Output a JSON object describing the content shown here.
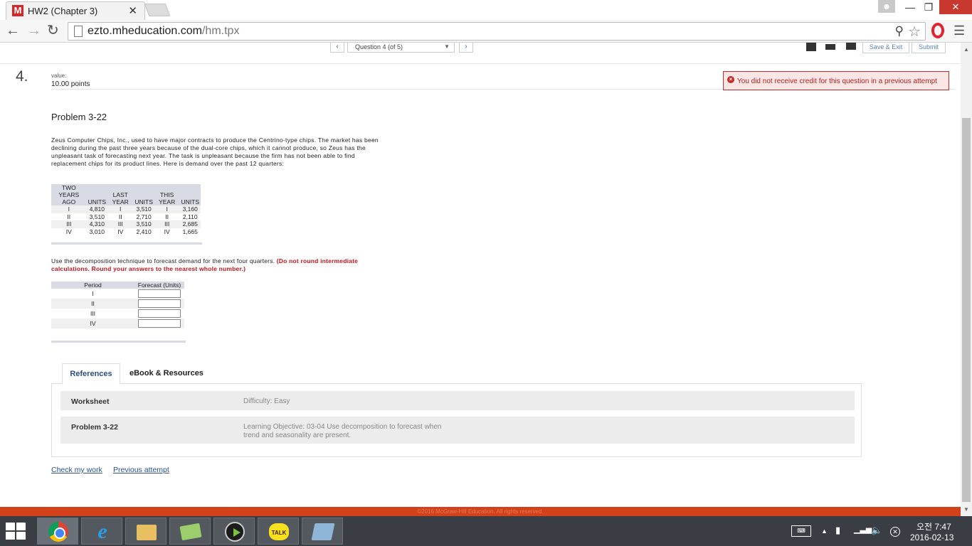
{
  "browser": {
    "tab_favicon": "M",
    "tab_title": "HW2 (Chapter 3)",
    "tab_close": "✕",
    "url_host": "ezto.mheducation.com",
    "url_path": "/hm.tpx"
  },
  "question_nav": {
    "prev": "‹",
    "next": "›",
    "selected": "Question 4 (of 5)",
    "save_exit": "Save & Exit",
    "submit": "Submit"
  },
  "question": {
    "number": "4.",
    "value_label": "value:",
    "value_points": "10.00 points",
    "alert": "You did not receive credit for this question in a previous attempt",
    "title": "Problem 3-22",
    "text": "Zeus Computer Chips, Inc., used to have major contracts to produce the Centrino-type chips. The market has been declining during the past three years because of the dual-core chips, which it cannot produce, so Zeus has the unpleasant task of forecasting next year. The task is unpleasant because the firm has not been able to find replacement chips for its product lines. Here is demand over the past 12 quarters:",
    "instruction": "Use the decomposition technique to forecast demand for the next four quarters.",
    "instruction_red": "(Do not round intermediate calculations. Round your answers to the nearest whole number.)"
  },
  "demand_table": {
    "headers": [
      "TWO YEARS AGO",
      "UNITS",
      "LAST YEAR",
      "UNITS",
      "THIS YEAR",
      "UNITS"
    ],
    "rows": [
      [
        "I",
        "4,810",
        "I",
        "3,510",
        "I",
        "3,160"
      ],
      [
        "II",
        "3,510",
        "II",
        "2,710",
        "II",
        "2,110"
      ],
      [
        "III",
        "4,310",
        "III",
        "3,510",
        "III",
        "2,685"
      ],
      [
        "IV",
        "3,010",
        "IV",
        "2,410",
        "IV",
        "1,665"
      ]
    ]
  },
  "forecast_table": {
    "header_period": "Period",
    "header_forecast": "Forecast (Units)",
    "periods": [
      "I",
      "II",
      "III",
      "IV"
    ]
  },
  "references": {
    "tab_references": "References",
    "tab_ebook": "eBook & Resources",
    "rows": [
      {
        "name": "Worksheet",
        "value": "Difficulty: Easy"
      },
      {
        "name": "Problem 3-22",
        "value": "Learning Objective: 03-04 Use decomposition to forecast when trend and seasonality are present."
      }
    ]
  },
  "links": {
    "check": "Check my work",
    "previous": "Previous attempt"
  },
  "footer": "©2016 McGraw-Hill Education. All rights reserved.",
  "taskbar": {
    "talk_label": "TALK",
    "time": "오전 7:47",
    "date": "2016-02-13"
  }
}
